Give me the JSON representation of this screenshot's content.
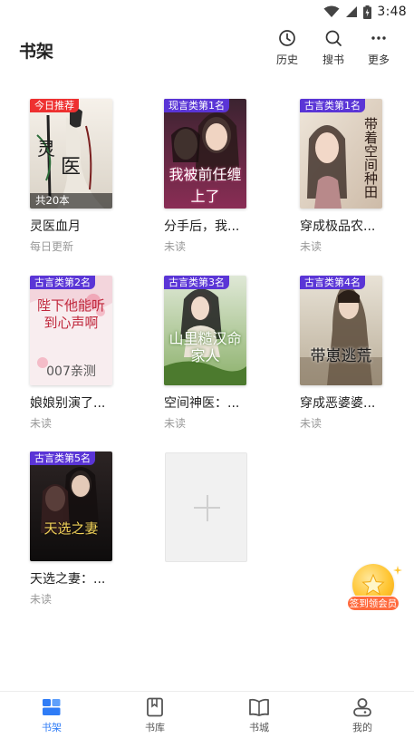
{
  "status_bar": {
    "time": "3:48",
    "icons": [
      "wifi-icon",
      "signal-icon",
      "battery-icon"
    ]
  },
  "header": {
    "title": "书架",
    "actions": [
      {
        "label": "历史",
        "icon": "clock-icon"
      },
      {
        "label": "搜书",
        "icon": "search-icon"
      },
      {
        "label": "更多",
        "icon": "more-dots-icon"
      }
    ]
  },
  "books": [
    {
      "title": "灵医血月",
      "status": "每日更新",
      "badge": "今日推荐",
      "badge_type": "recommend",
      "chapter_count": "共20本"
    },
    {
      "title": "分手后，我...",
      "status": "未读",
      "badge": "现言类第1名",
      "badge_type": "rank",
      "cover_text": "我被前任缠上了"
    },
    {
      "title": "穿成极品农...",
      "status": "未读",
      "badge": "古言类第1名",
      "badge_type": "rank",
      "cover_text": "带着空间种田"
    },
    {
      "title": "娘娘别演了...",
      "status": "未读",
      "badge": "古言类第2名",
      "badge_type": "rank",
      "cover_text": "陛下他能听到心声啊",
      "cover_sub": "007亲测"
    },
    {
      "title": "空间神医：...",
      "status": "未读",
      "badge": "古言类第3名",
      "badge_type": "rank",
      "cover_text": "山里糙汉命家人"
    },
    {
      "title": "穿成恶婆婆...",
      "status": "未读",
      "badge": "古言类第4名",
      "badge_type": "rank",
      "cover_text": "带崽逃荒"
    },
    {
      "title": "天选之妻：...",
      "status": "未读",
      "badge": "古言类第5名",
      "badge_type": "rank",
      "cover_text": "天选之妻"
    }
  ],
  "add_slot": {
    "icon": "plus-icon"
  },
  "sign_in": {
    "label": "签到领会员"
  },
  "bottom_nav": [
    {
      "label": "书架",
      "icon": "bookshelf-icon",
      "active": true
    },
    {
      "label": "书库",
      "icon": "library-icon",
      "active": false
    },
    {
      "label": "书城",
      "icon": "open-book-icon",
      "active": false
    },
    {
      "label": "我的",
      "icon": "profile-icon",
      "active": false
    }
  ],
  "colors": {
    "accent": "#2f7cf6",
    "rank_badge": "#5a35d6",
    "recommend_badge": "#ee3030"
  }
}
